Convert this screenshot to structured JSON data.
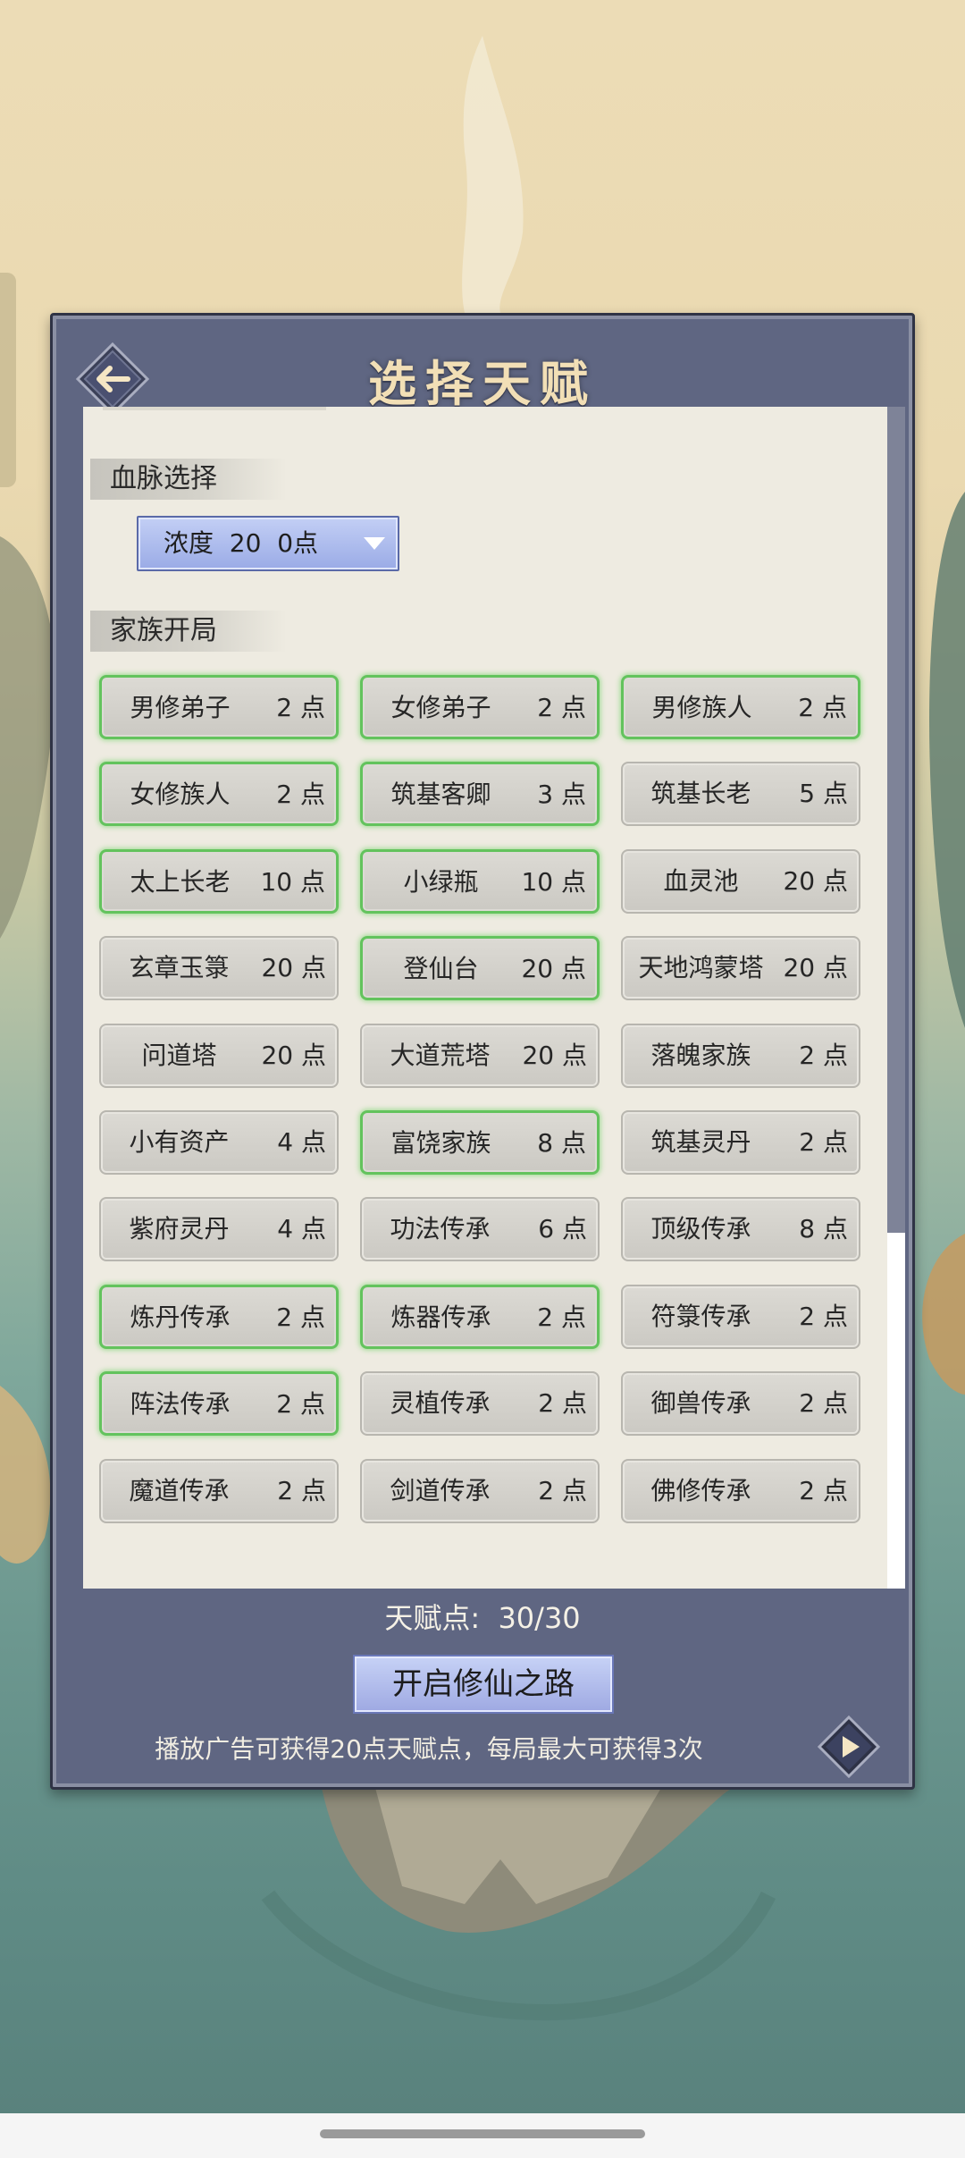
{
  "title": "选择天赋",
  "sections": {
    "bloodline": "血脉选择",
    "family": "家族开局"
  },
  "dropdown": {
    "value": "浓度  20  0点"
  },
  "talents": [
    {
      "name": "男修弟子",
      "points": "2 点",
      "selected": true
    },
    {
      "name": "女修弟子",
      "points": "2 点",
      "selected": true
    },
    {
      "name": "男修族人",
      "points": "2 点",
      "selected": true
    },
    {
      "name": "女修族人",
      "points": "2 点",
      "selected": true
    },
    {
      "name": "筑基客卿",
      "points": "3 点",
      "selected": true
    },
    {
      "name": "筑基长老",
      "points": "5 点",
      "selected": false
    },
    {
      "name": "太上长老",
      "points": "10 点",
      "selected": true
    },
    {
      "name": "小绿瓶",
      "points": "10 点",
      "selected": true
    },
    {
      "name": "血灵池",
      "points": "20 点",
      "selected": false
    },
    {
      "name": "玄章玉箓",
      "points": "20 点",
      "selected": false
    },
    {
      "name": "登仙台",
      "points": "20 点",
      "selected": true
    },
    {
      "name": "天地鸿蒙塔",
      "points": "20 点",
      "selected": false
    },
    {
      "name": "问道塔",
      "points": "20 点",
      "selected": false
    },
    {
      "name": "大道荒塔",
      "points": "20 点",
      "selected": false
    },
    {
      "name": "落魄家族",
      "points": "2 点",
      "selected": false
    },
    {
      "name": "小有资产",
      "points": "4 点",
      "selected": false
    },
    {
      "name": "富饶家族",
      "points": "8 点",
      "selected": true
    },
    {
      "name": "筑基灵丹",
      "points": "2 点",
      "selected": false
    },
    {
      "name": "紫府灵丹",
      "points": "4 点",
      "selected": false
    },
    {
      "name": "功法传承",
      "points": "6 点",
      "selected": false
    },
    {
      "name": "顶级传承",
      "points": "8 点",
      "selected": false
    },
    {
      "name": "炼丹传承",
      "points": "2 点",
      "selected": true
    },
    {
      "name": "炼器传承",
      "points": "2 点",
      "selected": true
    },
    {
      "name": "符箓传承",
      "points": "2 点",
      "selected": false
    },
    {
      "name": "阵法传承",
      "points": "2 点",
      "selected": true
    },
    {
      "name": "灵植传承",
      "points": "2 点",
      "selected": false
    },
    {
      "name": "御兽传承",
      "points": "2 点",
      "selected": false
    },
    {
      "name": "魔道传承",
      "points": "2 点",
      "selected": false
    },
    {
      "name": "剑道传承",
      "points": "2 点",
      "selected": false
    },
    {
      "name": "佛修传承",
      "points": "2 点",
      "selected": false
    }
  ],
  "talent_points": "天赋点:  30/30",
  "start_button": "开启修仙之路",
  "ad_note": "播放广告可获得20点天赋点，每局最大可获得3次",
  "icons": {
    "back": "back-arrow-icon",
    "next": "play-arrow-icon",
    "dropdown": "triangle-down-icon"
  },
  "colors": {
    "panel": "#5f6682",
    "content": "#eeebe1",
    "selected_border": "#63c35d",
    "title": "#f2dfb6"
  }
}
